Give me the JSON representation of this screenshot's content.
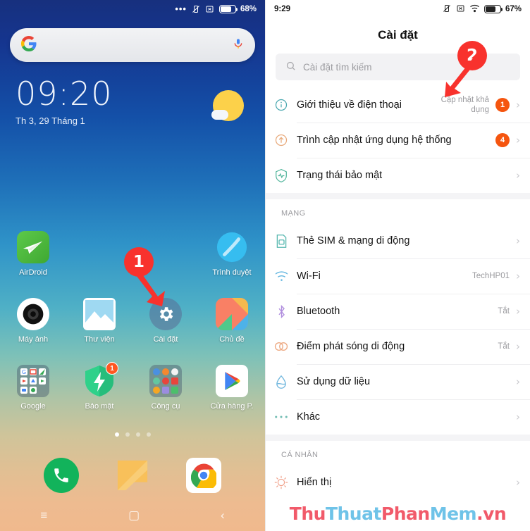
{
  "home": {
    "statusbar": {
      "overflow_icon": "three-dots-icon",
      "vibrate_icon": "vibrate-off-icon",
      "alarm_icon": "alarm-x-icon",
      "battery_icon": "battery-icon",
      "battery_percent": "68%"
    },
    "search_widget": {
      "logo_icon": "google-g-icon",
      "mic_icon": "microphone-icon"
    },
    "clock": {
      "time": "09:20",
      "date": "Th 3, 29 Tháng 1"
    },
    "weather_icon": "sun-cloud-icon",
    "apps": [
      [
        {
          "label": "AirDroid",
          "icon": "airdroid-icon",
          "badge": ""
        },
        {
          "label": "",
          "icon": "",
          "badge": ""
        },
        {
          "label": "",
          "icon": "",
          "badge": ""
        },
        {
          "label": "Trình duyệt",
          "icon": "browser-icon",
          "badge": ""
        }
      ],
      [
        {
          "label": "Máy ảnh",
          "icon": "camera-icon",
          "badge": ""
        },
        {
          "label": "Thư viện",
          "icon": "gallery-icon",
          "badge": ""
        },
        {
          "label": "Cài đặt",
          "icon": "settings-gear-icon",
          "badge": ""
        },
        {
          "label": "Chủ đề",
          "icon": "themes-icon",
          "badge": ""
        }
      ],
      [
        {
          "label": "Google",
          "icon": "google-folder-icon",
          "badge": ""
        },
        {
          "label": "Bảo mật",
          "icon": "security-shield-icon",
          "badge": "1"
        },
        {
          "label": "Công cụ",
          "icon": "tools-folder-icon",
          "badge": ""
        },
        {
          "label": "Cửa hàng P.",
          "icon": "play-store-icon",
          "badge": ""
        }
      ]
    ],
    "page_dots": {
      "count": 4,
      "active": 1
    },
    "dock": [
      {
        "label": "phone",
        "icon": "phone-icon"
      },
      {
        "label": "messages",
        "icon": "messages-icon"
      },
      {
        "label": "chrome",
        "icon": "chrome-icon"
      }
    ],
    "navbar": [
      {
        "icon": "menu-icon",
        "glyph": "≡"
      },
      {
        "icon": "home-square-icon",
        "glyph": "▢"
      },
      {
        "icon": "back-icon",
        "glyph": "‹"
      }
    ],
    "marker": {
      "number": "1"
    }
  },
  "settings": {
    "statusbar": {
      "clock": "9:29",
      "vibrate_icon": "vibrate-off-icon",
      "alarm_icon": "alarm-x-icon",
      "wifi_icon": "wifi-icon",
      "battery_icon": "battery-icon",
      "battery_percent": "67%"
    },
    "title": "Cài đặt",
    "search": {
      "icon": "search-icon",
      "placeholder": "Cài đặt tìm kiếm",
      "value": ""
    },
    "marker": {
      "number": "2"
    },
    "groups": [
      {
        "header": "",
        "rows": [
          {
            "icon": "info-circle-icon",
            "label": "Giới thiệu về điện thoại",
            "value": "Cập nhật khả dụng",
            "badge": "1",
            "chevron": "›"
          },
          {
            "icon": "system-update-icon",
            "label": "Trình cập nhật ứng dụng hệ thống",
            "value": "",
            "badge": "4",
            "chevron": "›"
          },
          {
            "icon": "security-status-icon",
            "label": "Trạng thái bảo mật",
            "value": "",
            "badge": "",
            "chevron": "›"
          }
        ]
      },
      {
        "header": "MẠNG",
        "rows": [
          {
            "icon": "sim-card-icon",
            "label": "Thẻ SIM & mạng di động",
            "value": "",
            "badge": "",
            "chevron": "›"
          },
          {
            "icon": "wifi-icon",
            "label": "Wi-Fi",
            "value": "TechHP01",
            "badge": "",
            "chevron": "›"
          },
          {
            "icon": "bluetooth-icon",
            "label": "Bluetooth",
            "value": "Tắt",
            "badge": "",
            "chevron": "›"
          },
          {
            "icon": "hotspot-icon",
            "label": "Điểm phát sóng di động",
            "value": "Tắt",
            "badge": "",
            "chevron": "›"
          },
          {
            "icon": "data-usage-icon",
            "label": "Sử dụng dữ liệu",
            "value": "",
            "badge": "",
            "chevron": "›"
          },
          {
            "icon": "more-dots-icon",
            "label": "Khác",
            "value": "",
            "badge": "",
            "chevron": "›"
          }
        ]
      },
      {
        "header": "CÁ NHÂN",
        "rows": [
          {
            "icon": "display-brightness-icon",
            "label": "Hiển thị",
            "value": "",
            "badge": "",
            "chevron": "›"
          }
        ]
      }
    ],
    "watermark": {
      "p1": "Thu",
      "p2": "Thuat",
      "p3": "Phan",
      "p4": "Mem",
      "p5": ".vn"
    }
  }
}
